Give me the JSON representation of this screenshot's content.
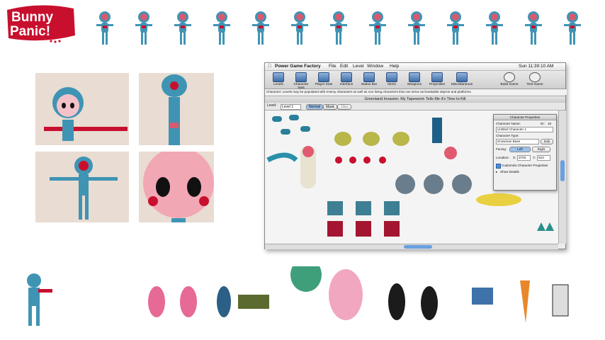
{
  "logo": {
    "line1": "Bunny",
    "line2": "Panic!"
  },
  "app": {
    "apple_icon": "apple-icon",
    "menu": [
      "Power Game Factory",
      "File",
      "Edit",
      "Level",
      "Window",
      "Help"
    ],
    "clock": "Sun 11:39:10 AM",
    "toolbar": [
      "Levels",
      "Character Sets",
      "Player Sets",
      "Interface",
      "Status Bar",
      "Items",
      "Weapons",
      "Projectiles",
      "Miscellaneous",
      "Build Game",
      "Test Game"
    ],
    "description": "Character: Levels may be populated with enemy characters as well as non living characters that can serve as breakable objects and platforms.",
    "document_title": "Greenland Invasion: My Tapeworm Tells Me it's Time to Kill",
    "level_label": "Level:",
    "level_value": "Level 1",
    "modes": [
      "Normal",
      "Mask",
      "Tiles"
    ],
    "properties": {
      "title": "Character Properties",
      "name_label": "Character Name:",
      "id_label": "ID:",
      "id_value": "16",
      "name_value": "Untitled Character 1",
      "type_label": "Character Type:",
      "type_value": "Snowman Base",
      "edit_label": "Edit",
      "facing_label": "Facing:",
      "facing_left": "Left",
      "facing_right": "Right",
      "location_label": "Location:",
      "x_label": "X:",
      "x_value": "3703",
      "y_label": "Y:",
      "y_value": "623",
      "customize_label": "Customize Character Properties",
      "show_details": "Show Details"
    }
  }
}
